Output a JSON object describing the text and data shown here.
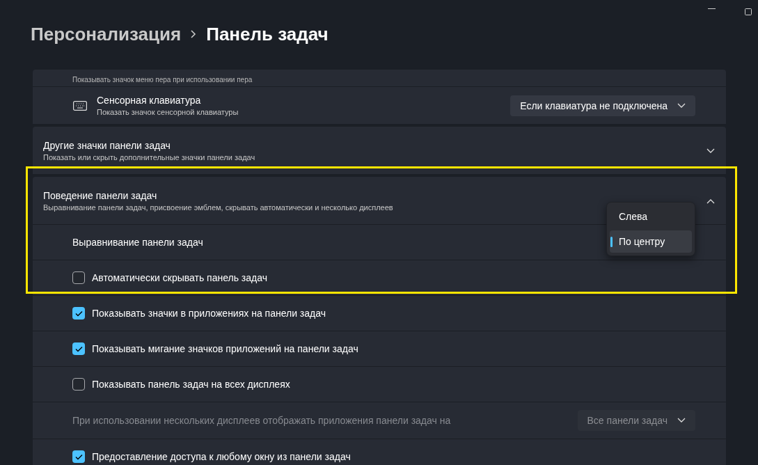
{
  "breadcrumb": {
    "parent": "Персонализация",
    "current": "Панель задач"
  },
  "rows": [
    {
      "kind": "partial",
      "description": "Показывать значок меню пера при использовании пера"
    },
    {
      "kind": "icon_dropdown",
      "title": "Сенсорная клавиатура",
      "description": "Показать значок сенсорной клавиатуры",
      "value": "Если клавиатура не подключена"
    },
    {
      "kind": "card",
      "title": "Другие значки панели задач",
      "description": "Показать или скрыть дополнительные значки панели задач",
      "expanded": false
    },
    {
      "kind": "card",
      "title": "Поведение панели задач",
      "description": "Выравнивание панели задач, присвоение эмблем, скрывать автоматически и несколько дисплеев",
      "expanded": true
    },
    {
      "kind": "menu_row",
      "label": "Выравнивание панели задач",
      "options": [
        {
          "label": "Слева",
          "selected": false
        },
        {
          "label": "По центру",
          "selected": true
        }
      ]
    },
    {
      "kind": "checkbox",
      "label": "Автоматически скрывать панель задач",
      "checked": false
    },
    {
      "kind": "checkbox",
      "label": "Показывать значки в приложениях на панели задач",
      "checked": true
    },
    {
      "kind": "checkbox",
      "label": "Показывать мигание значков приложений на панели задач",
      "checked": true
    },
    {
      "kind": "checkbox",
      "label": "Показывать панель задач на всех дисплеях",
      "checked": false
    },
    {
      "kind": "dropdown_row",
      "label": "При использовании нескольких дисплеев отображать приложения панели задач на",
      "value": "Все панели задач",
      "disabled": true
    },
    {
      "kind": "checkbox",
      "label": "Предоставление доступа к любому окну из панели задач",
      "checked": true
    }
  ]
}
